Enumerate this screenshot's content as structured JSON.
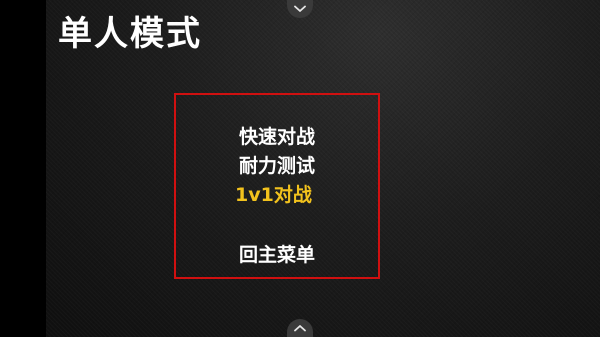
{
  "screen": {
    "title": "单人模式"
  },
  "menu": {
    "items": [
      {
        "label": "快速对战",
        "selected": false
      },
      {
        "label": "耐力测试",
        "selected": false
      },
      {
        "label": "1v1对战",
        "selected": true
      },
      {
        "label": "回主菜单",
        "selected": false
      }
    ],
    "border_color": "#d01010",
    "selected_color": "#f2c21d"
  },
  "icons": {
    "top_button": "chevron-down-icon",
    "bottom_button": "chevron-up-icon"
  }
}
